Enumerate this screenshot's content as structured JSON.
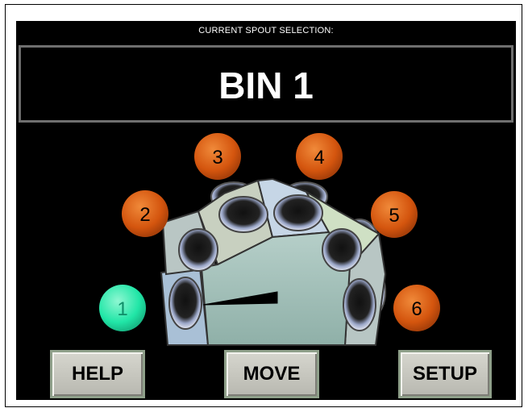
{
  "header": {
    "label": "CURRENT SPOUT SELECTION:"
  },
  "selection": {
    "value": "BIN 1"
  },
  "spouts": [
    {
      "label": "1",
      "selected": true
    },
    {
      "label": "2",
      "selected": false
    },
    {
      "label": "3",
      "selected": false
    },
    {
      "label": "4",
      "selected": false
    },
    {
      "label": "5",
      "selected": false
    },
    {
      "label": "6",
      "selected": false
    }
  ],
  "buttons": {
    "help": "HELP",
    "move": "MOVE",
    "setup": "SETUP"
  },
  "colors": {
    "background": "#000000",
    "spout_idle": "#d4550e",
    "spout_selected": "#21e6a7",
    "housing": "#9fbdb6"
  }
}
